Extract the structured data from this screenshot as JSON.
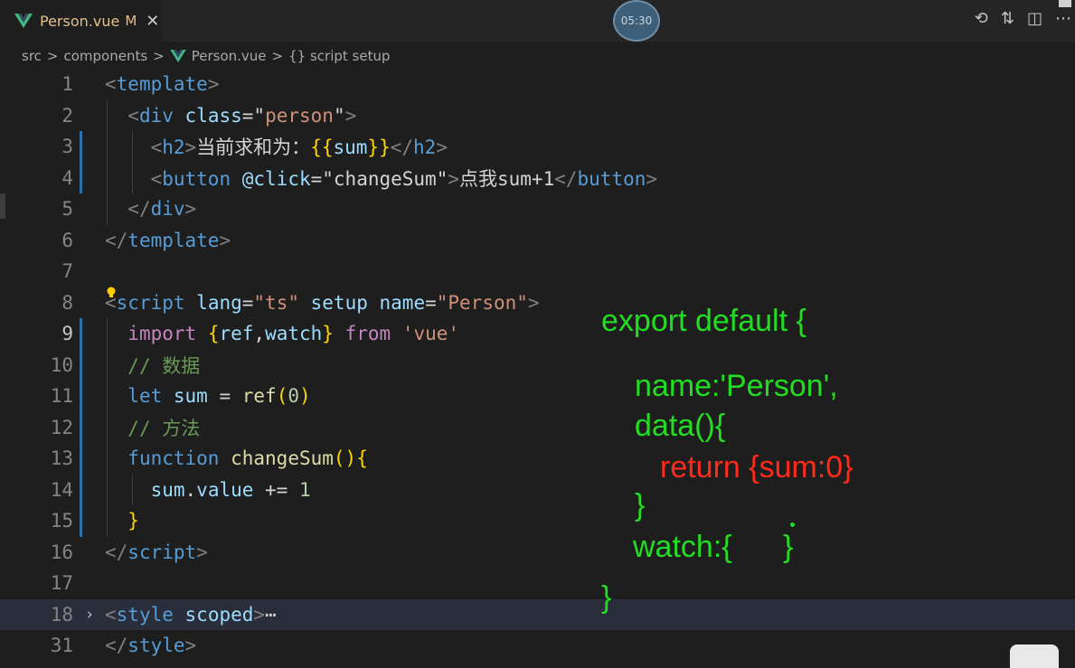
{
  "tab": {
    "file_name": "Person.vue",
    "modified": "M",
    "close": "✕"
  },
  "timer": "05:30",
  "breadcrumb": {
    "parts": [
      "src",
      "components",
      "Person.vue",
      "{} script setup"
    ],
    "sep": ">"
  },
  "editor": {
    "lines": [
      {
        "num": "1",
        "segs": [
          [
            "t-punc",
            "<"
          ],
          [
            "t-tag",
            "template"
          ],
          [
            "t-punc",
            ">"
          ]
        ]
      },
      {
        "num": "2",
        "segs": [
          [
            "t-text",
            "  "
          ],
          [
            "t-punc",
            "<"
          ],
          [
            "t-tag",
            "div"
          ],
          [
            "t-text",
            " "
          ],
          [
            "t-attr",
            "class"
          ],
          [
            "t-text",
            "="
          ],
          [
            "t-str-w",
            "\""
          ],
          [
            "t-str",
            "person"
          ],
          [
            "t-str-w",
            "\""
          ],
          [
            "t-punc",
            ">"
          ]
        ]
      },
      {
        "num": "3",
        "segs": [
          [
            "t-text",
            "    "
          ],
          [
            "t-punc",
            "<"
          ],
          [
            "t-tag",
            "h2"
          ],
          [
            "t-punc",
            ">"
          ],
          [
            "t-text",
            "当前求和为："
          ],
          [
            "t-brace",
            "{{"
          ],
          [
            "t-var",
            "sum"
          ],
          [
            "t-brace",
            "}}"
          ],
          [
            "t-punc",
            "</"
          ],
          [
            "t-tag",
            "h2"
          ],
          [
            "t-punc",
            ">"
          ]
        ]
      },
      {
        "num": "4",
        "segs": [
          [
            "t-text",
            "    "
          ],
          [
            "t-punc",
            "<"
          ],
          [
            "t-tag",
            "button"
          ],
          [
            "t-text",
            " "
          ],
          [
            "t-attr",
            "@click"
          ],
          [
            "t-text",
            "="
          ],
          [
            "t-str-w",
            "\"changeSum\""
          ],
          [
            "t-punc",
            ">"
          ],
          [
            "t-text",
            "点我sum+1"
          ],
          [
            "t-punc",
            "</"
          ],
          [
            "t-tag",
            "button"
          ],
          [
            "t-punc",
            ">"
          ]
        ]
      },
      {
        "num": "5",
        "segs": [
          [
            "t-text",
            "  "
          ],
          [
            "t-punc",
            "</"
          ],
          [
            "t-tag",
            "div"
          ],
          [
            "t-punc",
            ">"
          ]
        ]
      },
      {
        "num": "6",
        "segs": [
          [
            "t-punc",
            "</"
          ],
          [
            "t-tag",
            "template"
          ],
          [
            "t-punc",
            ">"
          ]
        ]
      },
      {
        "num": "7",
        "segs": []
      },
      {
        "num": "8",
        "segs": [
          [
            "t-punc",
            "<"
          ],
          [
            "t-tag",
            "script"
          ],
          [
            "t-text",
            " "
          ],
          [
            "t-attr",
            "lang"
          ],
          [
            "t-text",
            "="
          ],
          [
            "t-str",
            "\"ts\""
          ],
          [
            "t-text",
            " "
          ],
          [
            "t-attr",
            "setup"
          ],
          [
            "t-text",
            " "
          ],
          [
            "t-attr",
            "name"
          ],
          [
            "t-text",
            "="
          ],
          [
            "t-str",
            "\"Person\""
          ],
          [
            "t-punc",
            ">"
          ]
        ]
      },
      {
        "num": "9",
        "segs": [
          [
            "t-text",
            "  "
          ],
          [
            "t-kw2",
            "import"
          ],
          [
            "t-text",
            " "
          ],
          [
            "t-brace",
            "{"
          ],
          [
            "t-var",
            "ref"
          ],
          [
            "t-text",
            ","
          ],
          [
            "t-var",
            "watch"
          ],
          [
            "t-brace",
            "}"
          ],
          [
            "t-text",
            " "
          ],
          [
            "t-kw2",
            "from"
          ],
          [
            "t-text",
            " "
          ],
          [
            "t-str",
            "'vue'"
          ]
        ]
      },
      {
        "num": "10",
        "segs": [
          [
            "t-text",
            "  "
          ],
          [
            "t-com",
            "// 数据"
          ]
        ]
      },
      {
        "num": "11",
        "segs": [
          [
            "t-text",
            "  "
          ],
          [
            "t-kw",
            "let"
          ],
          [
            "t-text",
            " "
          ],
          [
            "t-var",
            "sum"
          ],
          [
            "t-text",
            " = "
          ],
          [
            "t-fn",
            "ref"
          ],
          [
            "t-brace",
            "("
          ],
          [
            "t-num",
            "0"
          ],
          [
            "t-brace",
            ")"
          ]
        ]
      },
      {
        "num": "12",
        "segs": [
          [
            "t-text",
            "  "
          ],
          [
            "t-com",
            "// 方法"
          ]
        ]
      },
      {
        "num": "13",
        "segs": [
          [
            "t-text",
            "  "
          ],
          [
            "t-kw",
            "function"
          ],
          [
            "t-text",
            " "
          ],
          [
            "t-fn",
            "changeSum"
          ],
          [
            "t-brace",
            "()"
          ],
          [
            "t-brace",
            "{"
          ]
        ]
      },
      {
        "num": "14",
        "segs": [
          [
            "t-text",
            "    "
          ],
          [
            "t-var",
            "sum"
          ],
          [
            "t-text",
            "."
          ],
          [
            "t-var",
            "value"
          ],
          [
            "t-text",
            " += "
          ],
          [
            "t-num",
            "1"
          ]
        ]
      },
      {
        "num": "15",
        "segs": [
          [
            "t-text",
            "  "
          ],
          [
            "t-brace",
            "}"
          ]
        ]
      },
      {
        "num": "16",
        "segs": [
          [
            "t-punc",
            "</"
          ],
          [
            "t-tag",
            "script"
          ],
          [
            "t-punc",
            ">"
          ]
        ]
      },
      {
        "num": "17",
        "segs": []
      },
      {
        "num": "18",
        "segs": [
          [
            "t-punc",
            "<"
          ],
          [
            "t-tag",
            "style"
          ],
          [
            "t-text",
            " "
          ],
          [
            "t-attr",
            "scoped"
          ],
          [
            "t-punc",
            ">"
          ],
          [
            "t-text",
            "⋯"
          ]
        ]
      },
      {
        "num": "31",
        "segs": [
          [
            "t-punc",
            "</"
          ],
          [
            "t-tag",
            "style"
          ],
          [
            "t-punc",
            ">"
          ]
        ]
      }
    ]
  },
  "annotations": {
    "line1": "export default {",
    "line2": "name:'Person',",
    "line3": "data(){",
    "line4": "return {sum:0}",
    "line5": "}",
    "line6": "watch:{",
    "line7": "}",
    "line8": "}"
  },
  "icons": {
    "history": "history-icon",
    "compare": "compare-changes-icon",
    "split": "split-editor-icon",
    "more": "more-actions-icon"
  }
}
